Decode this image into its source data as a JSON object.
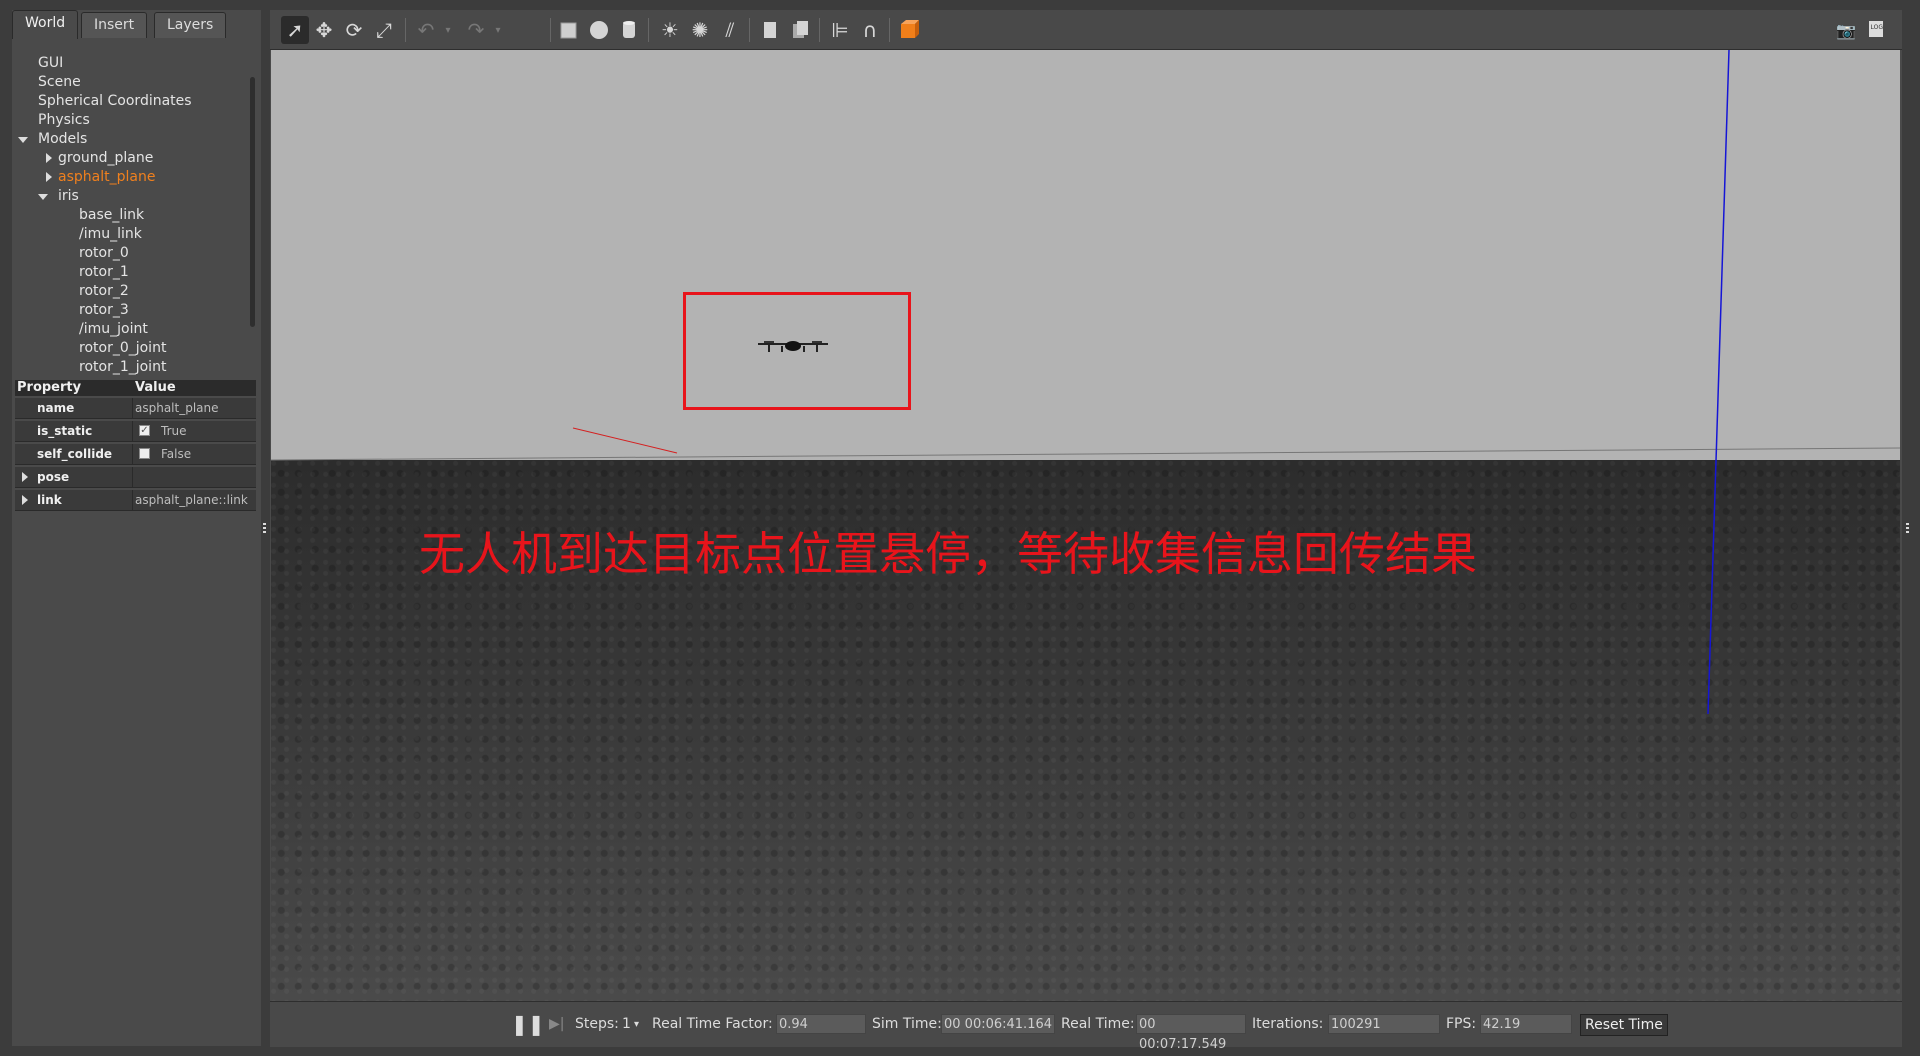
{
  "tabs": [
    "World",
    "Insert",
    "Layers"
  ],
  "tree": {
    "items": [
      "GUI",
      "Scene",
      "Spherical Coordinates",
      "Physics"
    ],
    "models_label": "Models",
    "models": [
      {
        "label": "ground_plane"
      },
      {
        "label": "asphalt_plane",
        "selected": true
      },
      {
        "label": "iris",
        "expanded": true,
        "children": [
          "base_link",
          "/imu_link",
          "rotor_0",
          "rotor_1",
          "rotor_2",
          "rotor_3",
          "/imu_joint",
          "rotor_0_joint",
          "rotor_1_joint"
        ]
      }
    ]
  },
  "properties": {
    "header_property": "Property",
    "header_value": "Value",
    "rows": [
      {
        "key": "name",
        "value": "asphalt_plane"
      },
      {
        "key": "is_static",
        "value": "True",
        "checked": true
      },
      {
        "key": "self_collide",
        "value": "False",
        "checked": false
      },
      {
        "key": "pose",
        "value": ""
      },
      {
        "key": "link",
        "value": "asphalt_plane::link"
      }
    ]
  },
  "toolbar": {
    "icons": [
      "select-arrow-icon",
      "translate-icon",
      "rotate-icon",
      "scale-icon",
      "undo-icon",
      "undo-dropdown-icon",
      "redo-icon",
      "redo-dropdown-icon",
      "box-icon",
      "sphere-icon",
      "cylinder-icon",
      "point-light-icon",
      "spot-light-icon",
      "directional-light-icon",
      "copy-icon",
      "paste-icon",
      "align-icon",
      "snap-icon",
      "view-angle-icon"
    ],
    "right_icons": [
      "screenshot-icon",
      "log-icon"
    ]
  },
  "overlay_text": "无人机到达目标点位置悬停，等待收集信息回传结果",
  "colors": {
    "annotation_red": "#e8141b",
    "selected_orange": "#f0801e",
    "sky": "#b3b3b3",
    "ground": "#333333"
  },
  "status": {
    "steps_label": "Steps:",
    "steps_value": "1",
    "rtf_label": "Real Time Factor:",
    "rtf_value": "0.94",
    "sim_time_label": "Sim Time:",
    "sim_time_value": "00 00:06:41.164",
    "real_time_label": "Real Time:",
    "real_time_value": "00 00:07:17.549",
    "iterations_label": "Iterations:",
    "iterations_value": "100291",
    "fps_label": "FPS:",
    "fps_value": "42.19",
    "reset_label": "Reset Time"
  }
}
